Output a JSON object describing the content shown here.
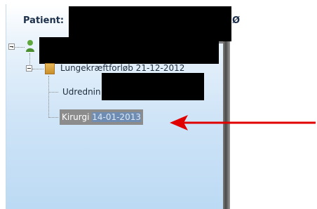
{
  "header": {
    "title_prefix": "Patient:",
    "title_tail": "Ø"
  },
  "tree": {
    "root_label_redacted": true,
    "course": {
      "label": "Lungekræftforløb 21-12-2012"
    },
    "children": [
      {
        "label": "Udrednin",
        "redacted_tail": true
      },
      {
        "label": "Kirurgi",
        "date": "14-01-2013",
        "selected": true
      }
    ]
  },
  "colors": {
    "annotation_arrow": "#e00000",
    "selection_bg": "#8c8c8c",
    "selection_date_bg": "#6f8db3"
  }
}
